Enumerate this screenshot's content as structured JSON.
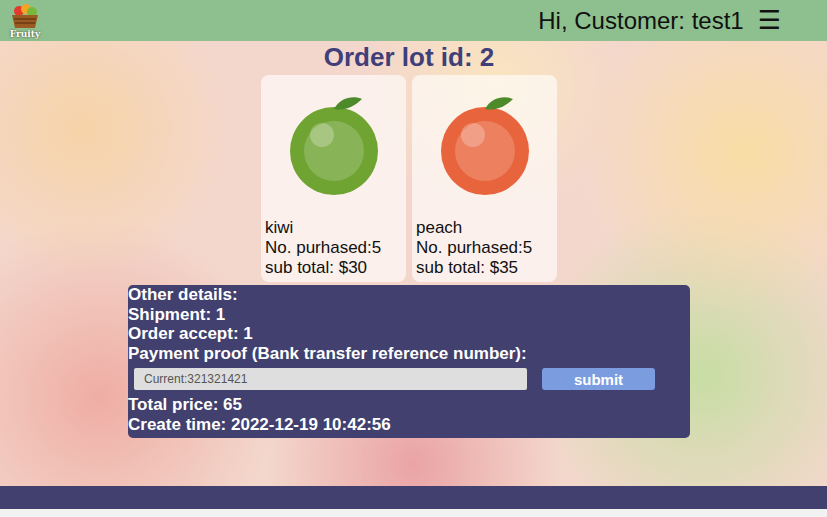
{
  "header": {
    "logo": "Fruity",
    "greeting": "Hi, Customer: test1",
    "menu": "☰"
  },
  "title": "Order lot id: 2",
  "items": [
    {
      "name": "kiwi",
      "purchased": "No. purhased:5",
      "subtotal": "sub total: $30",
      "color": "#6fa332"
    },
    {
      "name": "peach",
      "purchased": "No. purhased:5",
      "subtotal": "sub total: $35",
      "color": "#e8643c"
    }
  ],
  "details": {
    "heading": "Other details:",
    "shipment": "Shipment: 1",
    "accept": "Order accept: 1",
    "payment_label": "Payment proof (Bank transfer reference number):",
    "payment_placeholder": "Current:321321421",
    "submit": "submit",
    "total": "Total price: 65",
    "created": "Create time: 2022-12-19 10:42:56"
  }
}
